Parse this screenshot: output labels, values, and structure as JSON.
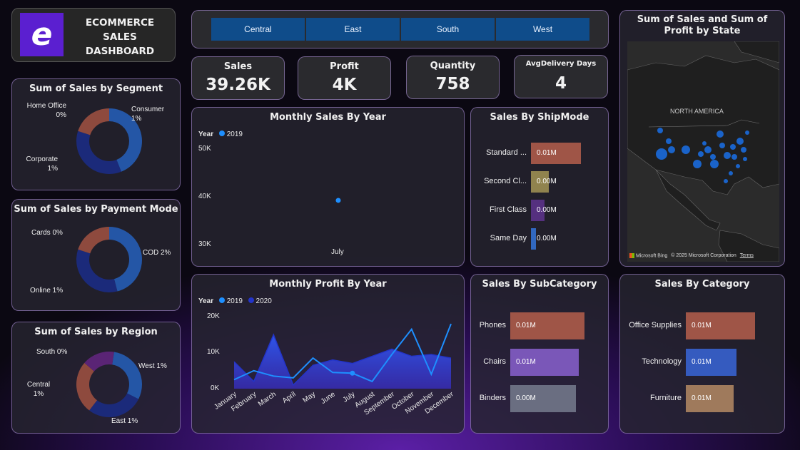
{
  "header": {
    "title_line1": "ECOMMERCE SALES",
    "title_line2": "DASHBOARD",
    "logo_letter": "e"
  },
  "slicer": {
    "regions": [
      "Central",
      "East",
      "South",
      "West"
    ]
  },
  "kpis": [
    {
      "title": "Sales",
      "value": "39.26K"
    },
    {
      "title": "Profit",
      "value": "4K"
    },
    {
      "title": "Quantity",
      "value": "758"
    },
    {
      "title": "AvgDelivery Days",
      "value": "4"
    }
  ],
  "donuts": {
    "segment": {
      "title": "Sum of Sales by Segment",
      "labels": [
        {
          "name": "Home Office",
          "pct": "0%"
        },
        {
          "name": "Consumer",
          "pct": "1%"
        },
        {
          "name": "Corporate",
          "pct": "1%"
        }
      ]
    },
    "payment": {
      "title": "Sum of Sales by Payment Mode",
      "labels": [
        {
          "text": "Cards 0%"
        },
        {
          "text": "COD 2%"
        },
        {
          "text": "Online 1%"
        }
      ]
    },
    "region": {
      "title": "Sum of Sales by Region",
      "labels": [
        {
          "text": "South 0%"
        },
        {
          "text": "West 1%"
        },
        {
          "name": "Central",
          "pct": "1%"
        },
        {
          "text": "East 1%"
        }
      ]
    }
  },
  "monthly_sales": {
    "title": "Monthly Sales By Year",
    "legend_title": "Year",
    "legend_item": "2019",
    "x_label": "July",
    "y_ticks": [
      "50K",
      "40K",
      "30K"
    ]
  },
  "shipmode": {
    "title": "Sales By ShipMode",
    "rows": [
      {
        "cat": "Standard ...",
        "val": "0.01M"
      },
      {
        "cat": "Second Cl...",
        "val": "0.00M"
      },
      {
        "cat": "First Class",
        "val": "0.00M"
      },
      {
        "cat": "Same Day",
        "val": "0.00M"
      }
    ]
  },
  "map": {
    "title": "Sum of Sales and Sum of Profit by State",
    "region_label": "NORTH AMERICA",
    "attribution": "Microsoft Bing",
    "copyright": "© 2025 Microsoft Corporation",
    "terms": "Terms"
  },
  "monthly_profit": {
    "title": "Monthly Profit By Year",
    "legend_title": "Year",
    "legend_items": [
      "2019",
      "2020"
    ],
    "y_ticks": [
      "20K",
      "10K",
      "0K"
    ],
    "months": [
      "January",
      "February",
      "March",
      "April",
      "May",
      "June",
      "July",
      "August",
      "September",
      "October",
      "November",
      "December"
    ]
  },
  "subcategory": {
    "title": "Sales By SubCategory",
    "rows": [
      {
        "cat": "Phones",
        "val": "0.01M"
      },
      {
        "cat": "Chairs",
        "val": "0.01M"
      },
      {
        "cat": "Binders",
        "val": "0.00M"
      }
    ]
  },
  "category": {
    "title": "Sales By Category",
    "rows": [
      {
        "cat": "Office Supplies",
        "val": "0.01M"
      },
      {
        "cat": "Technology",
        "val": "0.01M"
      },
      {
        "cat": "Furniture",
        "val": "0.01M"
      }
    ]
  },
  "chart_data": [
    {
      "type": "pie",
      "title": "Sum of Sales by Segment",
      "categories": [
        "Consumer",
        "Corporate",
        "Home Office"
      ],
      "values": [
        0.44,
        0.36,
        0.2
      ],
      "colors": [
        "#2456a6",
        "#1b2a7a",
        "#8e4a3e"
      ]
    },
    {
      "type": "pie",
      "title": "Sum of Sales by Payment Mode",
      "categories": [
        "COD",
        "Online",
        "Cards"
      ],
      "values": [
        0.46,
        0.34,
        0.2
      ],
      "colors": [
        "#2456a6",
        "#1b2a7a",
        "#8e4a3e"
      ]
    },
    {
      "type": "pie",
      "title": "Sum of Sales by Region",
      "categories": [
        "West",
        "East",
        "Central",
        "South"
      ],
      "values": [
        0.3,
        0.28,
        0.26,
        0.16
      ],
      "colors": [
        "#2456a6",
        "#1b2a7a",
        "#8e4a3e",
        "#5a2475"
      ]
    },
    {
      "type": "scatter",
      "title": "Monthly Sales By Year",
      "legend_title": "Year",
      "x": [
        "July"
      ],
      "series": [
        {
          "name": "2019",
          "values": [
            39260
          ]
        }
      ],
      "ylim": [
        30000,
        50000
      ],
      "colors": [
        "#1e8fff"
      ]
    },
    {
      "type": "area",
      "title": "Monthly Profit By Year",
      "legend_title": "Year",
      "categories": [
        "January",
        "February",
        "March",
        "April",
        "May",
        "June",
        "July",
        "August",
        "September",
        "October",
        "November",
        "December"
      ],
      "series": [
        {
          "name": "2019",
          "values": [
            2500,
            5000,
            3500,
            3000,
            8500,
            4500,
            4300,
            2000,
            9500,
            16500,
            4000,
            18000
          ]
        },
        {
          "name": "2020",
          "values": [
            7500,
            2000,
            15000,
            1000,
            6500,
            8000,
            7000,
            9000,
            11000,
            9000,
            9500,
            8500
          ]
        }
      ],
      "ylim": [
        0,
        20000
      ],
      "colors": [
        "#1e8fff",
        "#2334c9"
      ]
    },
    {
      "type": "bar",
      "title": "Sales By ShipMode",
      "categories": [
        "Standard ...",
        "Second Cl...",
        "First Class",
        "Same Day"
      ],
      "values": [
        0.012,
        0.0042,
        0.0032,
        0.0012
      ],
      "colors": [
        "#8a4a3e",
        "#7d7244",
        "#4a2a6e",
        "#2b5aa8"
      ]
    },
    {
      "type": "bar",
      "title": "Sales By SubCategory",
      "categories": [
        "Phones",
        "Chairs",
        "Binders"
      ],
      "values": [
        0.0104,
        0.0096,
        0.0092
      ],
      "colors": [
        "#8a4a3e",
        "#6a4ca0",
        "#5c6070"
      ]
    },
    {
      "type": "bar",
      "title": "Sales By Category",
      "categories": [
        "Office Supplies",
        "Technology",
        "Furniture"
      ],
      "values": [
        0.0098,
        0.0072,
        0.0068
      ],
      "colors": [
        "#8a4a3e",
        "#2e4fa6",
        "#8a6a50"
      ]
    }
  ]
}
